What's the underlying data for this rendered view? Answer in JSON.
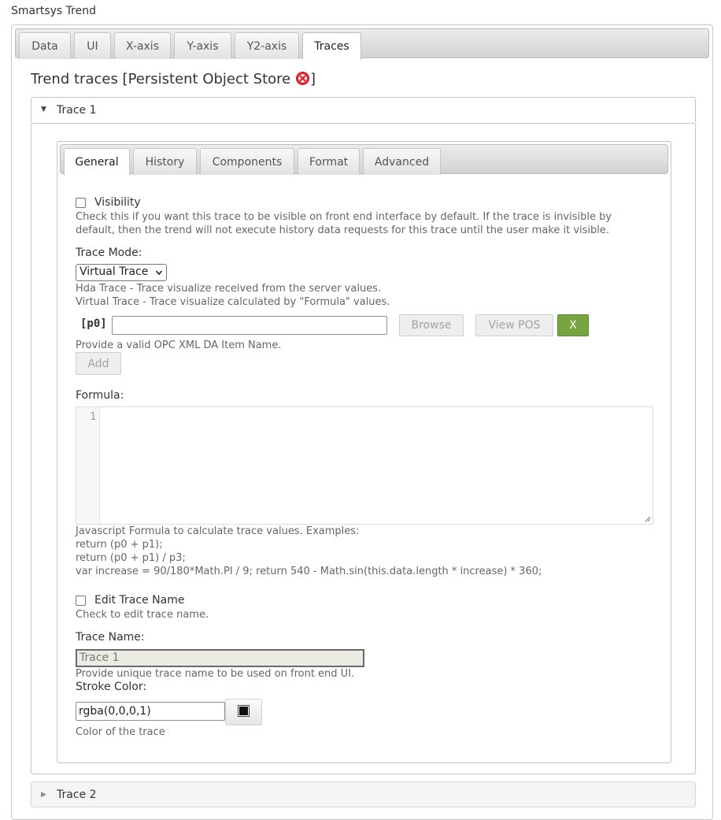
{
  "app": {
    "title": "Smartsys Trend"
  },
  "main_tabs": [
    {
      "label": "Data"
    },
    {
      "label": "UI"
    },
    {
      "label": "X-axis"
    },
    {
      "label": "Y-axis"
    },
    {
      "label": "Y2-axis"
    },
    {
      "label": "Traces",
      "active": true
    }
  ],
  "section": {
    "title": "Trend traces [Persistent Object Store ",
    "title_suffix": "]",
    "status_icon": "red-x-circle-icon"
  },
  "traces": [
    {
      "label": "Trace 1",
      "expanded": true,
      "tabs": [
        {
          "label": "General",
          "active": true
        },
        {
          "label": "History"
        },
        {
          "label": "Components"
        },
        {
          "label": "Format"
        },
        {
          "label": "Advanced"
        }
      ],
      "general": {
        "visibility": {
          "label": "Visibility",
          "checked": false,
          "help_line1": "Check this if you want this trace to be visible on front end interface by default. If the trace is invisible by",
          "help_line2": "default, then the trend will not execute history data requests for this trace until the user make it visible."
        },
        "trace_mode": {
          "label": "Trace Mode:",
          "selected": "Virtual Trace",
          "help_line1": "Hda Trace - Trace visualize received from the server values.",
          "help_line2": "Virtual Trace - Trace visualize calculated by \"Formula\" values."
        },
        "param": {
          "name": "[p0]",
          "value": "",
          "browse_label": "Browse",
          "view_pos_label": "View POS",
          "remove_label": "X",
          "help": "Provide a valid OPC XML DA Item Name.",
          "add_label": "Add"
        },
        "formula": {
          "label": "Formula:",
          "line_number": "1",
          "value": "",
          "help_line1": "Javascript Formula to calculate trace values. Examples:",
          "help_line2": "return (p0 + p1);",
          "help_line3": "return (p0 + p1) / p3;",
          "help_line4": "var increase = 90/180*Math.PI / 9; return 540 - Math.sin(this.data.length * increase) * 360;"
        },
        "edit_name": {
          "label": "Edit Trace Name",
          "checked": false,
          "help": "Check to edit trace name."
        },
        "trace_name": {
          "label": "Trace Name:",
          "value": "Trace 1",
          "help": "Provide unique trace name to be used on front end UI."
        },
        "stroke_color": {
          "label": "Stroke Color:",
          "value": "rgba(0,0,0,1)",
          "help": "Color of the trace",
          "picker_icon": "color-picker-icon"
        }
      }
    },
    {
      "label": "Trace 2",
      "expanded": false
    }
  ],
  "colors": {
    "accent_green": "#76a441",
    "tab_bar": "#d9d9d9",
    "store_error": "#d9232e"
  }
}
